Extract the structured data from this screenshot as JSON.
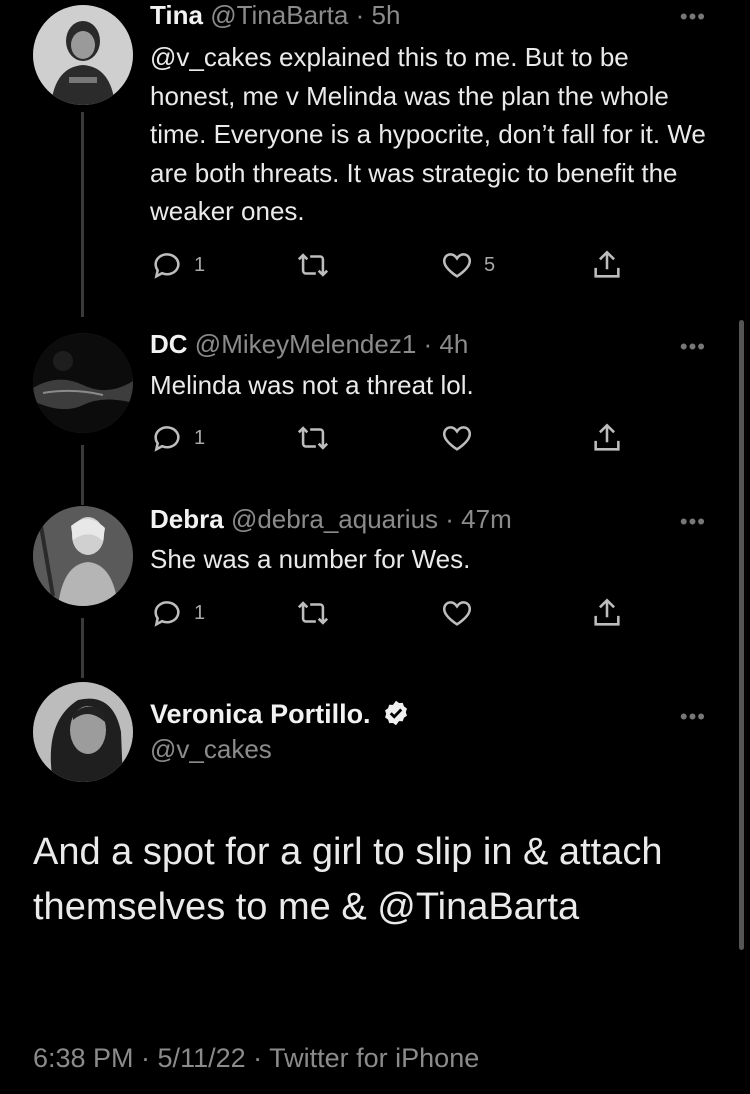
{
  "tweets": [
    {
      "name": "Tina",
      "handle": "@TinaBarta",
      "time": "5h",
      "text": "@v_cakes explained this to me.  But to be honest, me v Melinda was the plan the whole time. Everyone is a hypocrite, don’t fall for it. We are both threats. It was strategic to benefit the weaker ones.",
      "reply_count": "1",
      "retweet_count": "",
      "like_count": "5"
    },
    {
      "name": "DC",
      "handle": "@MikeyMelendez1",
      "time": "4h",
      "text": "Melinda was not a threat lol.",
      "reply_count": "1",
      "retweet_count": "",
      "like_count": ""
    },
    {
      "name": "Debra",
      "handle": "@debra_aquarius",
      "time": "47m",
      "text": "She was a number for Wes.",
      "reply_count": "1",
      "retweet_count": "",
      "like_count": ""
    }
  ],
  "main_tweet": {
    "name": "Veronica Portillo.",
    "handle": "@v_cakes",
    "text": "And a spot for a girl to slip in & attach themselves to me & @TinaBarta",
    "timestamp": "6:38 PM · 5/11/22 · Twitter for iPhone",
    "verified": true
  },
  "separator": "·",
  "more_glyph": "•••",
  "icons": {
    "reply": "reply-icon",
    "retweet": "retweet-icon",
    "like": "like-icon",
    "share": "share-icon",
    "verified": "verified-badge-icon",
    "more": "more-options-icon"
  }
}
